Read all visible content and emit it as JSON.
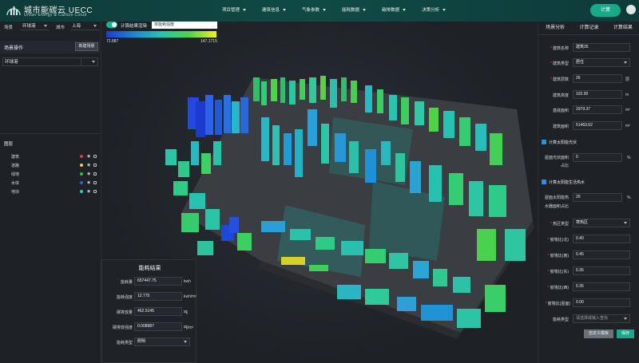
{
  "header": {
    "brand_title": "城市能碳云 UECC",
    "brand_sub": "Urban Energy & Carbon Cloud",
    "nav": [
      "项目管理",
      "建筑信息",
      "气象参数",
      "能耗数据",
      "碳排数据",
      "决策分析"
    ],
    "calc_label": "计算"
  },
  "left_panel": {
    "scene_label": "场景",
    "scene_value": "环球港",
    "city_label": "城市",
    "city_value": "上海",
    "scene_ops_title": "场景操作",
    "new_scene_label": "新建场景",
    "scene_select_value": "环球港",
    "layers_title": "图层",
    "layers": [
      {
        "name": "建筑",
        "color": "#e03b3b"
      },
      {
        "name": "道路",
        "color": "#f2d03b"
      },
      {
        "name": "绿地",
        "color": "#2fbf4a"
      },
      {
        "name": "水体",
        "color": "#2f5fe0"
      },
      {
        "name": "地块",
        "color": "#33c6c6"
      }
    ]
  },
  "legend": {
    "toggle_label": "计算结果渲染",
    "select_value": "单能耗强度",
    "min": "72.887",
    "max": "147.1715"
  },
  "result": {
    "title": "能耗结果",
    "rows": [
      {
        "label": "能耗量",
        "value": "657447.75",
        "unit": "kwh"
      },
      {
        "label": "能耗强度",
        "value": "12.775",
        "unit": "kwh/m²"
      },
      {
        "label": "碳排放量",
        "value": "462.5145",
        "unit": "吨"
      },
      {
        "label": "碳排放强度",
        "value": "0.008987",
        "unit": "吨/m²"
      },
      {
        "label": "能耗类型",
        "value": "照明",
        "unit": ""
      }
    ]
  },
  "right_panel": {
    "tabs": [
      "场景分析",
      "计算记录",
      "计算结果"
    ],
    "fields": [
      {
        "label": "建筑名称",
        "value": "建筑35",
        "unit": "",
        "required": true
      },
      {
        "label": "建筑类型",
        "value": "居住",
        "unit": "",
        "required": true,
        "select": true
      },
      {
        "label": "建筑层数",
        "value": "26",
        "unit": "层",
        "required": true
      },
      {
        "label": "建筑高度",
        "value": "102.00",
        "unit": "m",
        "required": false
      },
      {
        "label": "基底面积",
        "value": "1979.37",
        "unit": "m²",
        "required": false
      },
      {
        "label": "建筑面积",
        "value": "51463.62",
        "unit": "m²",
        "required": false
      }
    ],
    "solar_pv_label": "计算太阳能光伏",
    "pv_ratio_label_1": "屋面光伏面积",
    "pv_ratio_label_2": "占比",
    "pv_ratio_value": "0",
    "pv_ratio_unit": "%",
    "solar_hw_label": "计算太阳能生活热水",
    "hw_ratio_label_1": "屋面太阳能热",
    "hw_ratio_label_2": "水器面积占比",
    "hw_ratio_value": "20",
    "hw_ratio_unit": "%",
    "climate_label": "热区类型",
    "climate_value": "寒热区",
    "wwr": [
      {
        "label": "窗墙比(北)",
        "value": "0.40"
      },
      {
        "label": "窗墙比(南)",
        "value": "0.45"
      },
      {
        "label": "窗墙比(东)",
        "value": "0.35"
      },
      {
        "label": "窗墙比(西)",
        "value": "0.35"
      },
      {
        "label": "窗墙比(屋面)",
        "value": "0.00"
      }
    ],
    "energy_type_label": "能耗类型",
    "energy_type_placeholder": "请选择或输入查找",
    "custom_template_label": "自定义模板",
    "save_label": "保存"
  },
  "colors": {
    "accent": "#17a98a",
    "panel": "#1e2126"
  }
}
